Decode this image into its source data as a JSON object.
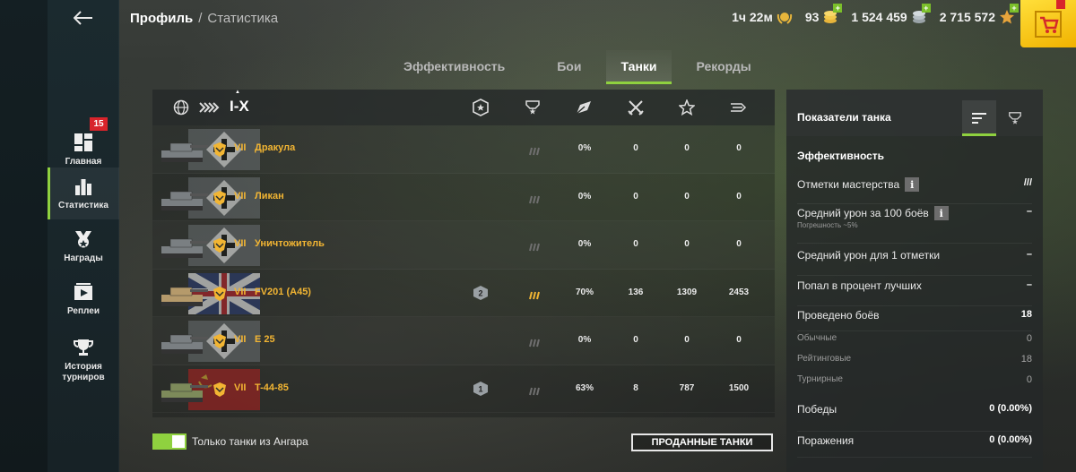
{
  "header": {
    "breadcrumb_profile": "Профиль",
    "breadcrumb_separator": "/",
    "breadcrumb_current": "Статистика",
    "premium_time": "1ч 22м",
    "gold": "93",
    "silver": "1 524 459",
    "free_xp": "2 715 572",
    "plus_sign": "+"
  },
  "sidebar": {
    "items": [
      {
        "label": "Главная",
        "icon": "home-grid-icon",
        "badge": "15"
      },
      {
        "label": "Статистика",
        "icon": "bar-chart-icon",
        "active": true
      },
      {
        "label": "Награды",
        "icon": "awards-icon"
      },
      {
        "label": "Реплеи",
        "icon": "replay-icon"
      },
      {
        "label": "История турниров",
        "icon": "trophy-icon"
      }
    ]
  },
  "tabs": [
    {
      "label": "Эффективность"
    },
    {
      "label": "Бои"
    },
    {
      "label": "Танки",
      "active": true
    },
    {
      "label": "Рекорды"
    }
  ],
  "table": {
    "tier_filter": "I-X",
    "column_icons": [
      "nation-globe-icon",
      "tank-type-icon",
      "mastery-badge-icon",
      "mark-of-excellence-icon",
      "win-rate-icon",
      "battles-icon",
      "avg-damage-icon",
      "avg-xp-icon"
    ],
    "rows": [
      {
        "tier": "VII",
        "name": "Дракула",
        "nation": "germany",
        "mastery": "",
        "win_rate": "0%",
        "battles": "0",
        "damage": "0",
        "xp": "0",
        "marks_active": false
      },
      {
        "tier": "VII",
        "name": "Ликан",
        "nation": "germany",
        "mastery": "",
        "win_rate": "0%",
        "battles": "0",
        "damage": "0",
        "xp": "0",
        "marks_active": false
      },
      {
        "tier": "VII",
        "name": "Уничтожитель",
        "nation": "germany",
        "mastery": "",
        "win_rate": "0%",
        "battles": "0",
        "damage": "0",
        "xp": "0",
        "marks_active": false
      },
      {
        "tier": "VII",
        "name": "FV201 (A45)",
        "nation": "uk",
        "mastery": "2",
        "win_rate": "70%",
        "battles": "136",
        "damage": "1309",
        "xp": "2453",
        "marks_active": true
      },
      {
        "tier": "VII",
        "name": "E 25",
        "nation": "germany",
        "mastery": "",
        "win_rate": "0%",
        "battles": "0",
        "damage": "0",
        "xp": "0",
        "marks_active": false
      },
      {
        "tier": "VII",
        "name": "T-44-85",
        "nation": "ussr",
        "mastery": "1",
        "win_rate": "63%",
        "battles": "8",
        "damage": "787",
        "xp": "1500",
        "marks_active": false
      }
    ]
  },
  "bottom": {
    "toggle_label": "Только танки из Ангара",
    "toggle_on": true,
    "sold_tanks_button": "ПРОДАННЫЕ ТАНКИ"
  },
  "panel": {
    "title": "Показатели танка",
    "section": "Эффективность",
    "rows": [
      {
        "label": "Отметки мастерства",
        "value": "///",
        "info": true
      },
      {
        "label": "Средний урон за 100 боёв",
        "sub": "Погрешность ~5%",
        "value": "–",
        "info": true
      },
      {
        "label": "Средний урон для 1 отметки",
        "value": "–"
      },
      {
        "label": "Попал в процент лучших",
        "value": "–"
      },
      {
        "label": "Проведено боёв",
        "value": "18"
      },
      {
        "label": "Обычные",
        "value": "0",
        "sub_row": true
      },
      {
        "label": "Рейтинговые",
        "value": "18",
        "sub_row": true
      },
      {
        "label": "Турнирные",
        "value": "0",
        "sub_row": true
      },
      {
        "label": "Победы",
        "value": "0 (0.00%)"
      },
      {
        "label": "Поражения",
        "value": "0 (0.00%)"
      }
    ]
  },
  "colors": {
    "accent_green": "#8fd13f",
    "tank_name": "#f2b533",
    "badge_red": "#d8242b",
    "shop_yellow": "#ffd21a"
  }
}
